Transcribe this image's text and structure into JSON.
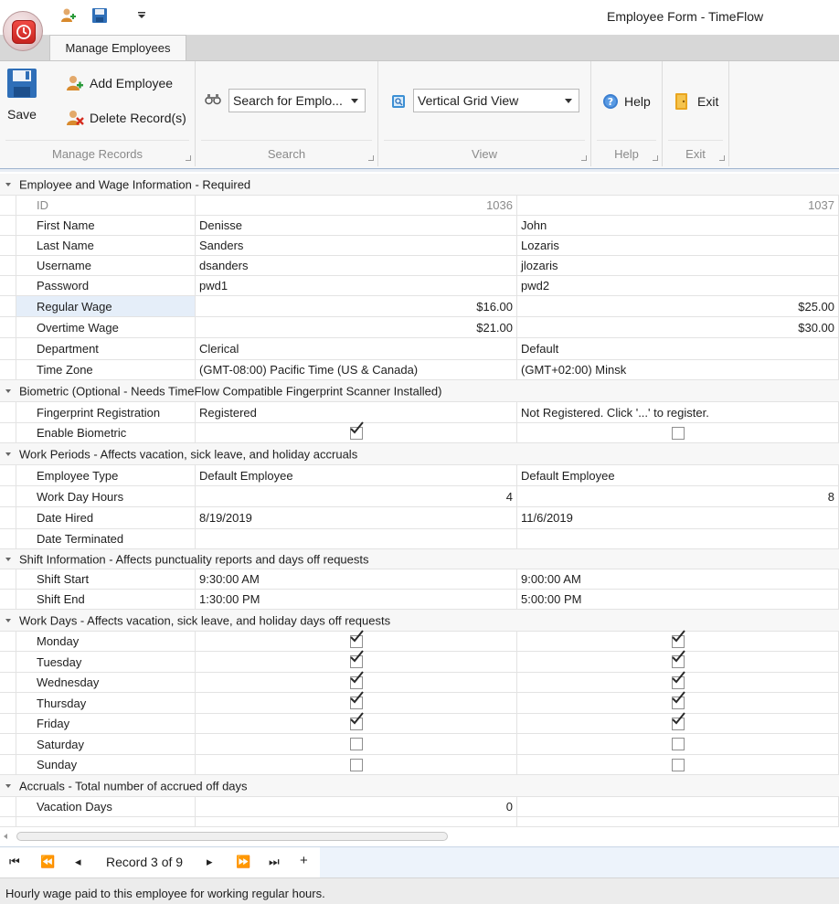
{
  "window": {
    "title": "Employee Form - TimeFlow"
  },
  "quick_access": {
    "icons": [
      "add-employee-icon",
      "save-icon",
      "customize-dropdown-icon"
    ]
  },
  "ribbon": {
    "tab_label": "Manage Employees",
    "groups": {
      "manage_records": {
        "label": "Manage Records",
        "save_label": "Save",
        "add_label": "Add Employee",
        "delete_label": "Delete Record(s)"
      },
      "search": {
        "label": "Search",
        "combo_value": "Search for Emplo..."
      },
      "view": {
        "label": "View",
        "combo_value": "Vertical Grid View"
      },
      "help": {
        "label": "Help",
        "button_label": "Help"
      },
      "exit": {
        "label": "Exit",
        "button_label": "Exit"
      }
    }
  },
  "grid": {
    "categories": {
      "wage": "Employee and Wage Information - Required",
      "biometric": "Biometric (Optional - Needs TimeFlow Compatible Fingerprint Scanner Installed)",
      "work_periods": "Work Periods - Affects vacation, sick leave, and holiday accruals",
      "shift": "Shift Information - Affects punctuality reports and days off requests",
      "work_days": "Work Days - Affects vacation, sick leave, and holiday days off requests",
      "accruals": "Accruals - Total number of accrued off days"
    },
    "labels": {
      "id": "ID",
      "first_name": "First Name",
      "last_name": "Last Name",
      "username": "Username",
      "password": "Password",
      "regular_wage": "Regular Wage",
      "overtime_wage": "Overtime Wage",
      "department": "Department",
      "time_zone": "Time Zone",
      "fingerprint": "Fingerprint Registration",
      "enable_biometric": "Enable Biometric",
      "employee_type": "Employee Type",
      "work_day_hours": "Work Day Hours",
      "date_hired": "Date Hired",
      "date_terminated": "Date Terminated",
      "shift_start": "Shift Start",
      "shift_end": "Shift End",
      "monday": "Monday",
      "tuesday": "Tuesday",
      "wednesday": "Wednesday",
      "thursday": "Thursday",
      "friday": "Friday",
      "saturday": "Saturday",
      "sunday": "Sunday",
      "vacation_days": "Vacation Days"
    },
    "records": [
      {
        "id": "1036",
        "first_name": "Denisse",
        "last_name": "Sanders",
        "username": "dsanders",
        "password": "pwd1",
        "regular_wage": "$16.00",
        "overtime_wage": "$21.00",
        "department": "Clerical",
        "time_zone": "(GMT-08:00) Pacific Time (US & Canada)",
        "fingerprint": "Registered",
        "enable_biometric": true,
        "employee_type": "Default Employee",
        "work_day_hours": "4",
        "date_hired": "8/19/2019",
        "date_terminated": "",
        "shift_start": "9:30:00 AM",
        "shift_end": "1:30:00 PM",
        "work_days": {
          "monday": true,
          "tuesday": true,
          "wednesday": true,
          "thursday": true,
          "friday": true,
          "saturday": false,
          "sunday": false
        },
        "vacation_days": "0"
      },
      {
        "id": "1037",
        "first_name": "John",
        "last_name": "Lozaris",
        "username": "jlozaris",
        "password": "pwd2",
        "regular_wage": "$25.00",
        "overtime_wage": "$30.00",
        "department": "Default",
        "time_zone": "(GMT+02:00) Minsk",
        "fingerprint": "Not Registered. Click '...' to register.",
        "enable_biometric": false,
        "employee_type": "Default Employee",
        "work_day_hours": "8",
        "date_hired": "11/6/2019",
        "date_terminated": "",
        "shift_start": "9:00:00 AM",
        "shift_end": "5:00:00 PM",
        "work_days": {
          "monday": true,
          "tuesday": true,
          "wednesday": true,
          "thursday": true,
          "friday": true,
          "saturday": false,
          "sunday": false
        },
        "vacation_days": ""
      }
    ],
    "selected_row": "regular_wage"
  },
  "navigator": {
    "record_text": "Record 3 of 9",
    "buttons": [
      "first-record",
      "previous-page",
      "previous-record",
      "next-record",
      "next-page",
      "last-record",
      "append-record"
    ]
  },
  "status": {
    "text": "Hourly wage paid to this employee for working regular hours."
  },
  "colors": {
    "accent_blue": "#2f6fb8",
    "orb_red": "#d9312c",
    "selection": "#e5eef9"
  }
}
